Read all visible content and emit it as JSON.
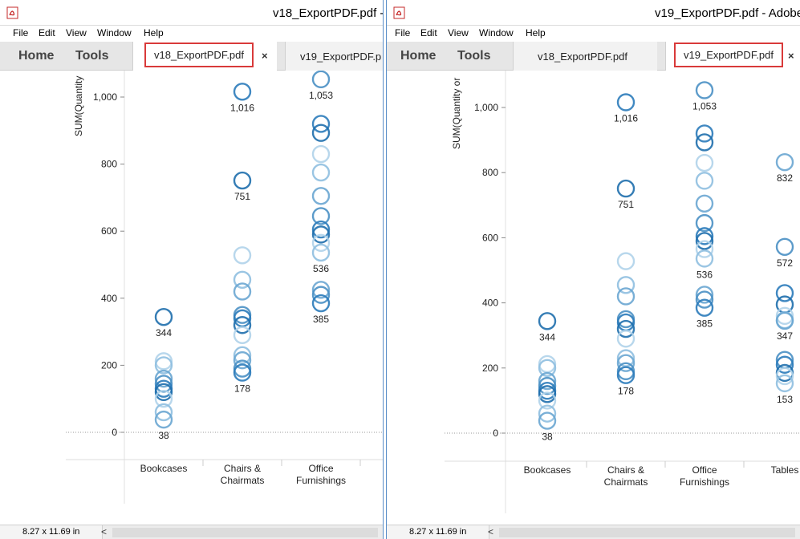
{
  "left_window": {
    "title": "v18_ExportPDF.pdf -",
    "menu": [
      "File",
      "Edit",
      "View",
      "Window",
      "Help"
    ],
    "nav": {
      "home": "Home",
      "tools": "Tools"
    },
    "tabs": [
      {
        "label": "v18_ExportPDF.pdf",
        "active": true,
        "close": "×"
      },
      {
        "label": "v19_ExportPDF.p",
        "active": false
      }
    ],
    "status": {
      "page_size": "8.27 x 11.69 in",
      "scroll_left": "<"
    },
    "chart_data": {
      "type": "scatter",
      "ylabel": "SUM(Quantity",
      "yticks": [
        "1,000",
        "800",
        "600",
        "400",
        "200",
        "0"
      ],
      "ytick_values": [
        1000,
        800,
        600,
        400,
        200,
        0
      ],
      "ylim": [
        0,
        1080
      ],
      "categories": [
        "Bookcases",
        "Chairs & Chairmats",
        "Office Furnishings"
      ],
      "category_labels": [
        [
          "Bookcases"
        ],
        [
          "Chairs &",
          "Chairmats"
        ],
        [
          "Office",
          "Furnishings"
        ]
      ],
      "series": [
        {
          "category": "Bookcases",
          "values": [
            344,
            212,
            200,
            160,
            145,
            130,
            120,
            100,
            60,
            38
          ]
        },
        {
          "category": "Chairs & Chairmats",
          "values": [
            1016,
            751,
            528,
            455,
            420,
            350,
            340,
            320,
            290,
            230,
            215,
            190,
            178
          ]
        },
        {
          "category": "Office Furnishings",
          "values": [
            1053,
            920,
            893,
            830,
            775,
            705,
            645,
            605,
            590,
            565,
            536,
            425,
            410,
            385
          ]
        }
      ],
      "labels": [
        {
          "category": "Bookcases",
          "value": 344,
          "text": "344"
        },
        {
          "category": "Bookcases",
          "value": 38,
          "text": "38"
        },
        {
          "category": "Chairs & Chairmats",
          "value": 1016,
          "text": "1,016"
        },
        {
          "category": "Chairs & Chairmats",
          "value": 751,
          "text": "751"
        },
        {
          "category": "Chairs & Chairmats",
          "value": 178,
          "text": "178"
        },
        {
          "category": "Office Furnishings",
          "value": 1053,
          "text": "1,053"
        },
        {
          "category": "Office Furnishings",
          "value": 536,
          "text": "536"
        },
        {
          "category": "Office Furnishings",
          "value": 385,
          "text": "385"
        }
      ]
    }
  },
  "right_window": {
    "title": "v19_ExportPDF.pdf - Adobe",
    "menu": [
      "File",
      "Edit",
      "View",
      "Window",
      "Help"
    ],
    "nav": {
      "home": "Home",
      "tools": "Tools"
    },
    "tabs": [
      {
        "label": "v18_ExportPDF.pdf",
        "active": false
      },
      {
        "label": "v19_ExportPDF.pdf",
        "active": true,
        "close": "×"
      }
    ],
    "status": {
      "page_size": "8.27 x 11.69 in",
      "scroll_left": "<"
    },
    "chart_data": {
      "type": "scatter",
      "ylabel": "SUM(Quantity or",
      "yticks": [
        "1,000",
        "800",
        "600",
        "400",
        "200",
        "0"
      ],
      "ytick_values": [
        1000,
        800,
        600,
        400,
        200,
        0
      ],
      "ylim": [
        0,
        1080
      ],
      "categories": [
        "Bookcases",
        "Chairs & Chairmats",
        "Office Furnishings",
        "Tables"
      ],
      "category_labels": [
        [
          "Bookcases"
        ],
        [
          "Chairs &",
          "Chairmats"
        ],
        [
          "Office",
          "Furnishings"
        ],
        [
          "Tables"
        ]
      ],
      "series": [
        {
          "category": "Bookcases",
          "values": [
            344,
            212,
            200,
            160,
            145,
            130,
            120,
            100,
            60,
            38
          ]
        },
        {
          "category": "Chairs & Chairmats",
          "values": [
            1016,
            751,
            528,
            455,
            420,
            350,
            340,
            320,
            290,
            230,
            215,
            190,
            178
          ]
        },
        {
          "category": "Office Furnishings",
          "values": [
            1053,
            920,
            893,
            830,
            775,
            705,
            645,
            605,
            590,
            565,
            536,
            425,
            410,
            385
          ]
        },
        {
          "category": "Tables",
          "values": [
            832,
            572,
            430,
            395,
            360,
            347,
            345,
            225,
            210,
            185,
            175,
            153
          ]
        }
      ],
      "labels": [
        {
          "category": "Bookcases",
          "value": 344,
          "text": "344"
        },
        {
          "category": "Bookcases",
          "value": 38,
          "text": "38"
        },
        {
          "category": "Chairs & Chairmats",
          "value": 1016,
          "text": "1,016"
        },
        {
          "category": "Chairs & Chairmats",
          "value": 751,
          "text": "751"
        },
        {
          "category": "Chairs & Chairmats",
          "value": 178,
          "text": "178"
        },
        {
          "category": "Office Furnishings",
          "value": 1053,
          "text": "1,053"
        },
        {
          "category": "Office Furnishings",
          "value": 536,
          "text": "536"
        },
        {
          "category": "Office Furnishings",
          "value": 385,
          "text": "385"
        },
        {
          "category": "Tables",
          "value": 832,
          "text": "832"
        },
        {
          "category": "Tables",
          "value": 572,
          "text": "572"
        },
        {
          "category": "Tables",
          "value": 347,
          "text": "347"
        },
        {
          "category": "Tables",
          "value": 153,
          "text": "153"
        }
      ]
    }
  },
  "colors": {
    "accent_red": "#d93a3a",
    "marker_blue": "#1f77b4",
    "window_border": "#5b8fc9"
  }
}
